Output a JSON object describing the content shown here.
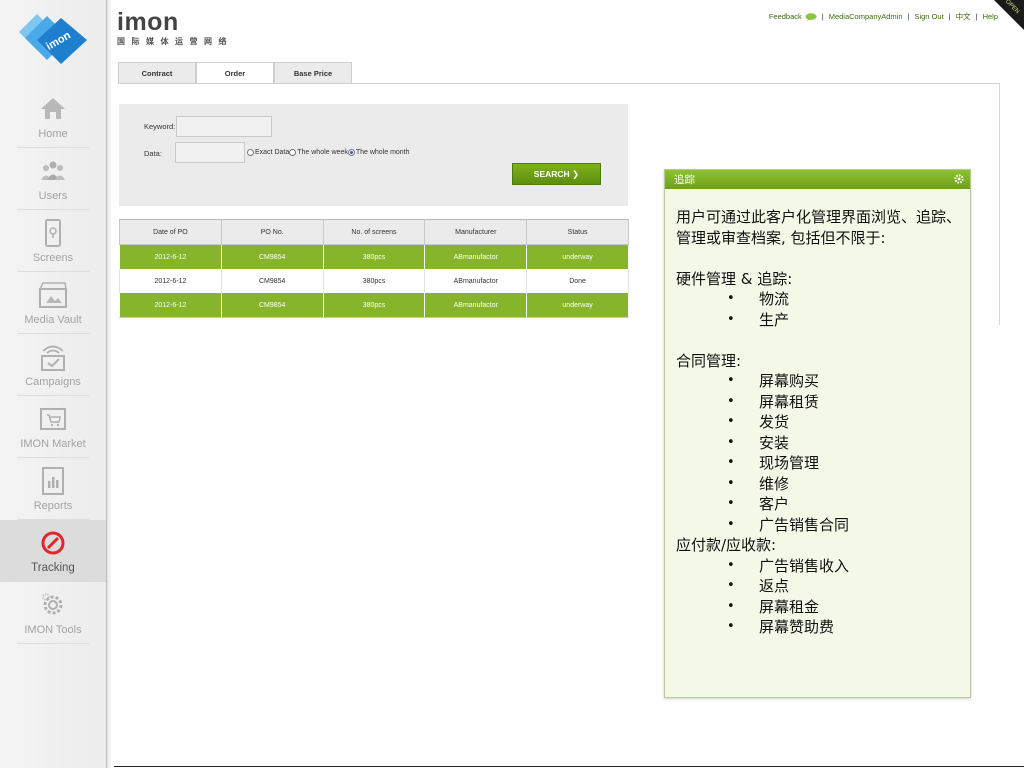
{
  "brand": {
    "logo_text": "imon",
    "name": "imon",
    "subtitle": "国际媒体运营网络"
  },
  "top_links": {
    "feedback": "Feedback",
    "user": "MediaCompanyAdmin",
    "sign_out": "Sign Out",
    "language": "中文",
    "help": "Help",
    "separator": "|",
    "corner": "OPEN"
  },
  "sidebar": {
    "items": [
      {
        "label": "Home",
        "icon": "home-icon",
        "active": false
      },
      {
        "label": "Users",
        "icon": "users-icon",
        "active": false
      },
      {
        "label": "Screens",
        "icon": "screens-icon",
        "active": false
      },
      {
        "label": "Media Vault",
        "icon": "media-vault-icon",
        "active": false
      },
      {
        "label": "Campaigns",
        "icon": "campaigns-icon",
        "active": false
      },
      {
        "label": "IMON Market",
        "icon": "market-icon",
        "active": false
      },
      {
        "label": "Reports",
        "icon": "reports-icon",
        "active": false
      },
      {
        "label": "Tracking",
        "icon": "tracking-icon",
        "active": true
      },
      {
        "label": "IMON Tools",
        "icon": "tools-icon",
        "active": false
      }
    ]
  },
  "tabs": [
    {
      "label": "Contract",
      "active": false
    },
    {
      "label": "Order",
      "active": true
    },
    {
      "label": "Base Price",
      "active": false
    }
  ],
  "search": {
    "keyword_label": "Keyword:",
    "keyword_value": "",
    "data_label": "Data:",
    "data_value": "",
    "radio_options": [
      {
        "label": "Exact Data",
        "selected": false
      },
      {
        "label": "The whole week",
        "selected": false
      },
      {
        "label": "The whole month",
        "selected": true
      }
    ],
    "button_label": "SEARCH ❯"
  },
  "table": {
    "columns": [
      "Date of PO",
      "PO No.",
      "No. of screens",
      "Manufacturer",
      "Status"
    ],
    "rows": [
      [
        "2012-6-12",
        "CM9854",
        "380pcs",
        "ABmanufactor",
        "underway"
      ],
      [
        "2012-6-12",
        "CM9854",
        "380pcs",
        "ABmanufactor",
        "Done"
      ],
      [
        "2012-6-12",
        "CM9854",
        "380pcs",
        "ABmanufactor",
        "underway"
      ]
    ]
  },
  "popup": {
    "title": "追踪",
    "intro": "用户可通过此客户化管理界面浏览、追踪、管理或审查档案, 包括但不限于:",
    "section1_title": "硬件管理 & 追踪:",
    "section1_items": [
      "物流",
      "生产"
    ],
    "section2_title": "合同管理:",
    "section2_items": [
      "屏幕购买",
      "屏幕租赁",
      "发货",
      "安装",
      "现场管理",
      "维修",
      "客户",
      "广告销售合同"
    ],
    "section3_title": "应付款/应收款:",
    "section3_items": [
      "广告销售收入",
      "返点",
      "屏幕租金",
      "屏幕赞助费"
    ]
  },
  "colors": {
    "accent_green": "#86b52b",
    "tab_border": "#cfcfcf",
    "logo_blue": "#2f8fd8",
    "tracking_red": "#e0262b"
  }
}
